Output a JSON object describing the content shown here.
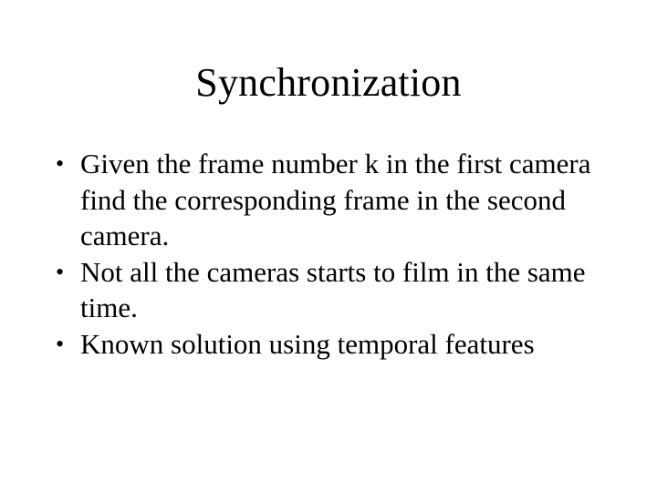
{
  "slide": {
    "background_color": "#ffffff",
    "text_color": "#000000",
    "title": "Synchronization",
    "bullet_marker": "•",
    "bullets": [
      {
        "text": "Given the frame number k in the first camera find the corresponding frame in the second camera."
      },
      {
        "text": "Not all the cameras starts to film in the same time."
      },
      {
        "text": "Known solution using temporal features"
      }
    ]
  }
}
